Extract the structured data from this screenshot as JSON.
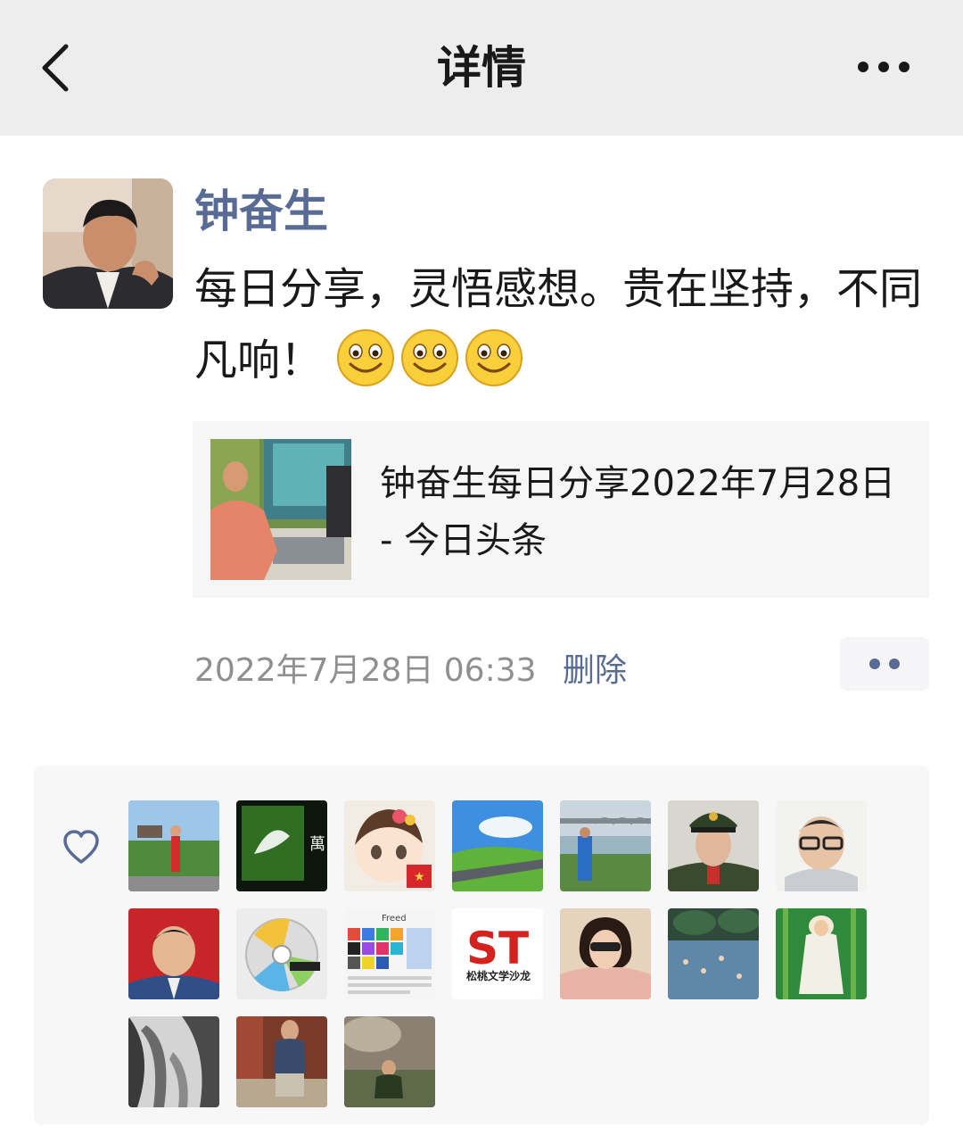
{
  "header": {
    "title": "详情",
    "back_icon": "chevron-left-icon",
    "more_icon": "more-dots-icon"
  },
  "post": {
    "author": "钟奋生",
    "text": "每日分享，灵悟感想。贵在坚持，不同凡响！",
    "emojis": [
      "smile-emoji",
      "smile-emoji",
      "smile-emoji"
    ],
    "link": {
      "title": "钟奋生每日分享2022年7月28日 - 今日头条"
    },
    "timestamp": "2022年7月28日 06:33",
    "delete_label": "删除"
  },
  "likes": {
    "icon": "heart-icon",
    "avatars": [
      "liker-1",
      "liker-2",
      "liker-3",
      "liker-4",
      "liker-5",
      "liker-6",
      "liker-7",
      "liker-8",
      "liker-9",
      "liker-10",
      "liker-11",
      "liker-12",
      "liker-13",
      "liker-14",
      "liker-15",
      "liker-16",
      "liker-17"
    ],
    "avatar_texts": [
      "萬",
      "ST",
      "松桃文学沙龙",
      "Freed"
    ]
  },
  "colors": {
    "header_bg": "#ededed",
    "link_blue": "#576b95",
    "timestamp_gray": "#8f8f8f",
    "card_bg": "#f6f6f6",
    "likes_bg": "#f7f7f7"
  }
}
